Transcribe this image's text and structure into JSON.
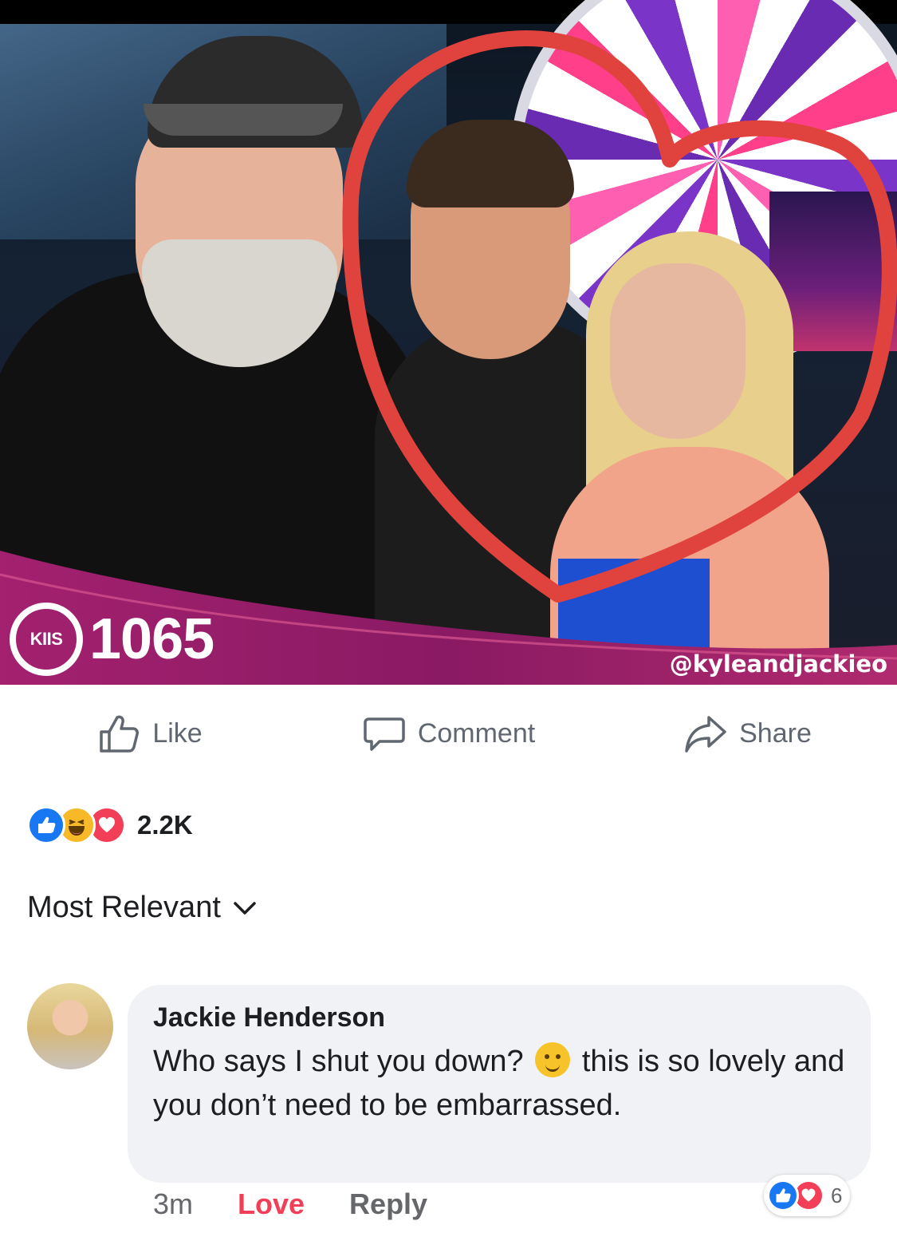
{
  "photo": {
    "brand_badge": "KIIS",
    "brand_number": "1065",
    "handle": "@kyleandjackieo",
    "heart_color": "#e0433d",
    "banner_color": "#9b1f6a"
  },
  "actions": {
    "like": "Like",
    "comment": "Comment",
    "share": "Share"
  },
  "reactions": {
    "types": [
      "like-icon",
      "haha-icon",
      "love-icon"
    ],
    "count": "2.2K"
  },
  "sort": {
    "label": "Most Relevant"
  },
  "comment": {
    "author": "Jackie Henderson",
    "text_before_emoji": "Who says I shut you down?",
    "emoji": "winking-face",
    "text_after_emoji": "this is so lovely and you don’t need to be embarrassed.",
    "time": "3m",
    "love_label": "Love",
    "reply_label": "Reply",
    "reaction_types": [
      "like-icon",
      "love-icon"
    ],
    "reaction_count": "6"
  },
  "colors": {
    "facebook_blue": "#1877f2",
    "love_red": "#f33e58",
    "haha_yellow": "#f7b928",
    "secondary_text": "#65676b",
    "bubble_bg": "#f0f2f5"
  }
}
